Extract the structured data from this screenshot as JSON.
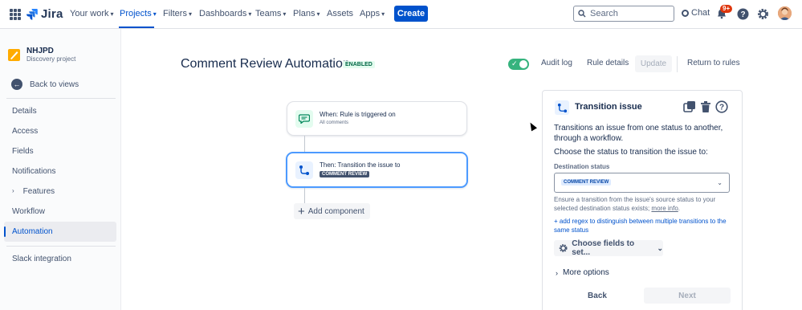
{
  "topnav": {
    "logo_text": "Jira",
    "items": [
      {
        "label": "Your work",
        "has_chevron": true
      },
      {
        "label": "Projects",
        "has_chevron": true,
        "active": true
      },
      {
        "label": "Filters",
        "has_chevron": true
      },
      {
        "label": "Dashboards",
        "has_chevron": true
      },
      {
        "label": "Teams",
        "has_chevron": true
      },
      {
        "label": "Plans",
        "has_chevron": true
      },
      {
        "label": "Assets",
        "has_chevron": false
      },
      {
        "label": "Apps",
        "has_chevron": true
      }
    ],
    "create_label": "Create",
    "search_placeholder": "Search",
    "chat_label": "Chat",
    "notifications_badge": "9+",
    "icons": [
      "app-switcher-icon",
      "search-icon",
      "chat-icon",
      "bell-icon",
      "help-icon",
      "settings-icon",
      "avatar"
    ],
    "accent_color": "#0052cc"
  },
  "sidebar": {
    "project_name": "NHJPD",
    "project_type": "Discovery project",
    "back_label": "Back to views",
    "items": [
      {
        "label": "Details"
      },
      {
        "label": "Access"
      },
      {
        "label": "Fields"
      },
      {
        "label": "Notifications"
      },
      {
        "label": "Features",
        "expandable": true
      },
      {
        "label": "Workflow"
      },
      {
        "label": "Automation",
        "active": true
      }
    ],
    "bottom_item": "Slack integration"
  },
  "main": {
    "title": "Comment Review Automation",
    "status": "ENABLED",
    "toggle_on": true,
    "audit_log": "Audit log",
    "rule_details": "Rule details",
    "update": "Update",
    "return": "Return to rules",
    "trigger": {
      "title": "When: Rule is triggered on",
      "subtitle": "All comments"
    },
    "action": {
      "title": "Then: Transition the issue to",
      "lozenge": "COMMENT REVIEW"
    },
    "add_component": "Add component"
  },
  "panel": {
    "title": "Transition issue",
    "description": "Transitions an issue from one status to another, through a workflow.",
    "choose": "Choose the status to transition the issue to:",
    "field_label": "Destination status",
    "selected_value": "COMMENT REVIEW",
    "helper_text": "Ensure a transition from the issue's source status to your selected destination status exists;",
    "helper_link": "more info",
    "regex_link": "+ add regex to distinguish between multiple transitions to the same status",
    "fields_button": "Choose fields to set...",
    "more_options": "More options",
    "back": "Back",
    "next": "Next"
  }
}
